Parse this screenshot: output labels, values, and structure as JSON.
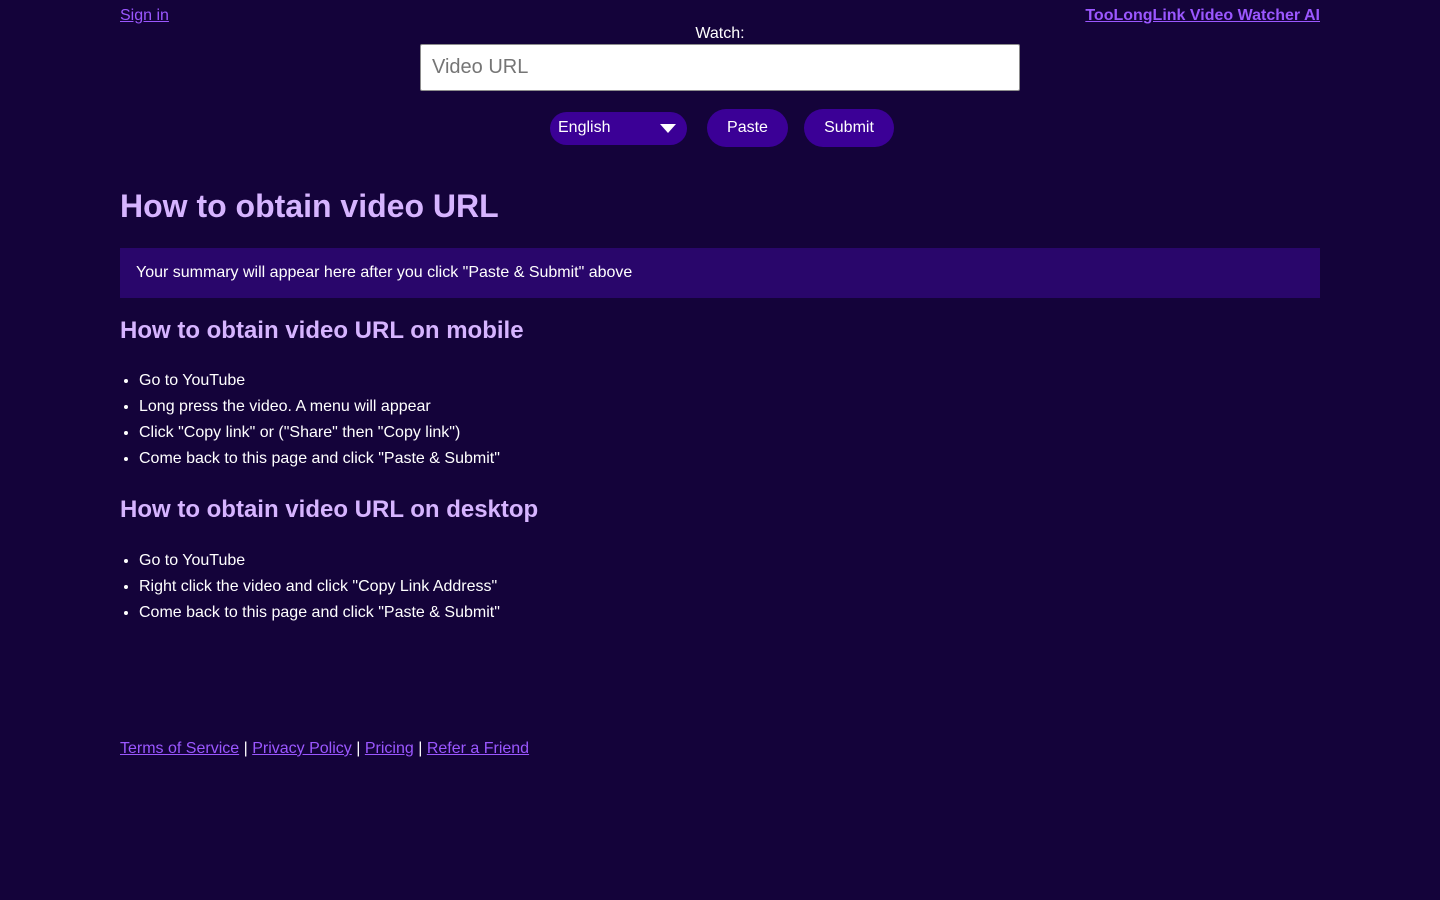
{
  "header": {
    "signin_label": "Sign in",
    "brand_label": "TooLongLink Video Watcher AI"
  },
  "watch": {
    "label": "Watch:",
    "url_placeholder": "Video URL",
    "language_selected": "English",
    "paste_label": "Paste",
    "submit_label": "Submit"
  },
  "main": {
    "title": "How to obtain video URL",
    "summary_placeholder": "Your summary will appear here after you click \"Paste & Submit\" above"
  },
  "mobile": {
    "title": "How to obtain video URL on mobile",
    "steps": [
      "Go to YouTube",
      "Long press the video. A menu will appear",
      "Click \"Copy link\" or (\"Share\" then \"Copy link\")",
      "Come back to this page and click \"Paste & Submit\""
    ]
  },
  "desktop": {
    "title": "How to obtain video URL on desktop",
    "steps": [
      "Go to YouTube",
      "Right click the video and click \"Copy Link Address\"",
      "Come back to this page and click \"Paste & Submit\""
    ]
  },
  "footer": {
    "links": [
      "Terms of Service",
      "Privacy Policy",
      "Pricing",
      "Refer a Friend"
    ],
    "separator": "|"
  },
  "colors": {
    "background": "#14033a",
    "accent": "#3b0096",
    "link": "#9b57ff",
    "heading": "#d6b4ff",
    "summary_bg": "#29066b"
  },
  "icons": {
    "language_dropdown": "chevron-down-icon"
  }
}
